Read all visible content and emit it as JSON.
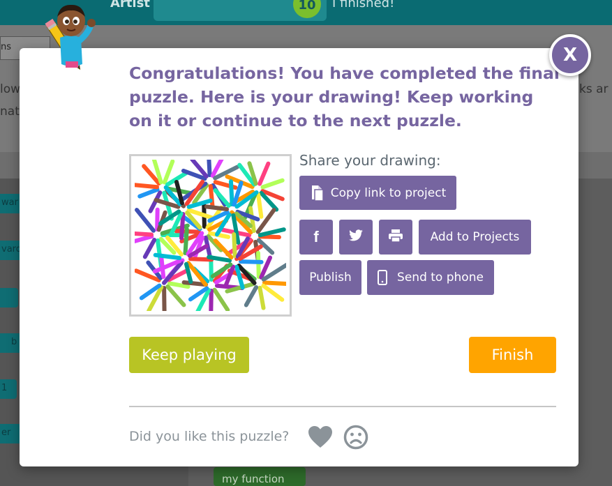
{
  "background": {
    "artist_label": "Artist",
    "level_number": "10",
    "finished_text": "I finished!",
    "tab_fragment": "ns",
    "text_fragments": [
      "low",
      "nat",
      "ks ar"
    ],
    "block_fragments": [
      "war",
      "vard",
      "b",
      "1",
      "er"
    ],
    "function_label": "my function"
  },
  "dialog": {
    "close_label": "X",
    "title": "Congratulations! You have completed the final puzzle. Here is your drawing! Keep working on it or continue to the next puzzle.",
    "share_label": "Share your drawing:",
    "buttons": {
      "copy_link": "Copy link to project",
      "add_to_projects": "Add to Projects",
      "publish": "Publish",
      "send_to_phone": "Send to phone",
      "keep_playing": "Keep playing",
      "finish": "Finish"
    },
    "feedback_label": "Did you like this puzzle?",
    "icons": {
      "copy": "copy-icon",
      "facebook": "facebook-icon",
      "twitter": "twitter-icon",
      "print": "print-icon",
      "phone": "phone-icon",
      "heart": "heart-icon",
      "sad": "sad-face-icon"
    }
  },
  "colors": {
    "accent": "#7665a0",
    "keep_playing": "#b8c424",
    "finish": "#ffa400"
  }
}
